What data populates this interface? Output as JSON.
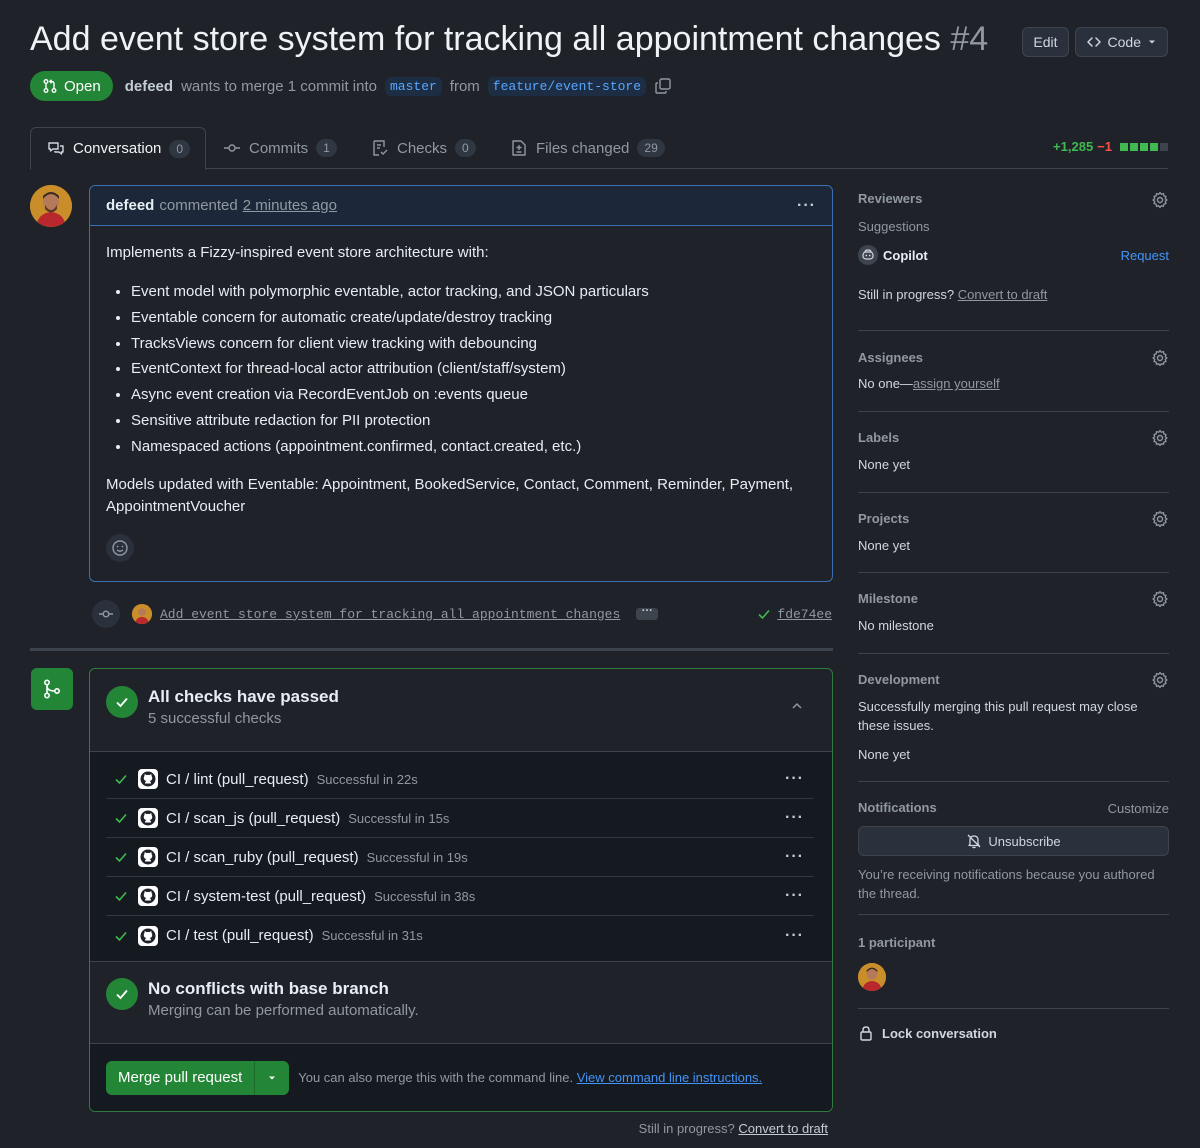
{
  "header": {
    "title": "Add event store system for tracking all appointment changes",
    "number": "#4",
    "edit_label": "Edit",
    "code_label": "Code",
    "state": "Open",
    "author": "defeed",
    "merge_text": "wants to merge 1 commit into",
    "base_branch": "master",
    "from_text": "from",
    "head_branch": "feature/event-store"
  },
  "tabs": [
    {
      "label": "Conversation",
      "count": "0"
    },
    {
      "label": "Commits",
      "count": "1"
    },
    {
      "label": "Checks",
      "count": "0"
    },
    {
      "label": "Files changed",
      "count": "29"
    }
  ],
  "diffstat": {
    "additions": "+1,285",
    "deletions": "−1",
    "colors": [
      "#3fb950",
      "#3fb950",
      "#3fb950",
      "#3fb950",
      "#3d444d"
    ]
  },
  "comment": {
    "author": "defeed",
    "action": "commented",
    "time": "2 minutes ago",
    "intro": "Implements a Fizzy-inspired event store architecture with:",
    "bullets": [
      "Event model with polymorphic eventable, actor tracking, and JSON particulars",
      "Eventable concern for automatic create/update/destroy tracking",
      "TracksViews concern for client view tracking with debouncing",
      "EventContext for thread-local actor attribution (client/staff/system)",
      "Async event creation via RecordEventJob on :events queue",
      "Sensitive attribute redaction for PII protection",
      "Namespaced actions (appointment.confirmed, contact.created, etc.)"
    ],
    "outro": "Models updated with Eventable: Appointment, BookedService, Contact, Comment, Reminder, Payment, AppointmentVoucher"
  },
  "commit": {
    "message": "Add event store system for tracking all appointment changes",
    "sha": "fde74ee"
  },
  "merge": {
    "checks_title": "All checks have passed",
    "checks_subtitle": "5 successful checks",
    "checks": [
      {
        "name": "CI / lint (pull_request)",
        "status": "Successful in 22s"
      },
      {
        "name": "CI / scan_js (pull_request)",
        "status": "Successful in 15s"
      },
      {
        "name": "CI / scan_ruby (pull_request)",
        "status": "Successful in 19s"
      },
      {
        "name": "CI / system-test (pull_request)",
        "status": "Successful in 38s"
      },
      {
        "name": "CI / test (pull_request)",
        "status": "Successful in 31s"
      }
    ],
    "conflicts_title": "No conflicts with base branch",
    "conflicts_subtitle": "Merging can be performed automatically.",
    "merge_button": "Merge pull request",
    "hint": "You can also merge this with the command line.",
    "hint_link": "View command line instructions.",
    "still_in_progress": "Still in progress?",
    "convert_to_draft": "Convert to draft"
  },
  "sidebar": {
    "reviewers": {
      "title": "Reviewers",
      "suggestions": "Suggestions",
      "copilot": "Copilot",
      "request": "Request",
      "still": "Still in progress?",
      "convert": "Convert to draft"
    },
    "assignees": {
      "title": "Assignees",
      "none": "No one—",
      "assign": "assign yourself"
    },
    "labels": {
      "title": "Labels",
      "value": "None yet"
    },
    "projects": {
      "title": "Projects",
      "value": "None yet"
    },
    "milestone": {
      "title": "Milestone",
      "value": "No milestone"
    },
    "development": {
      "title": "Development",
      "text": "Successfully merging this pull request may close these issues.",
      "value": "None yet"
    },
    "notifications": {
      "title": "Notifications",
      "customize": "Customize",
      "button": "Unsubscribe",
      "reason": "You’re receiving notifications because you authored the thread."
    },
    "participants": {
      "title": "1 participant"
    },
    "lock": "Lock conversation"
  },
  "colors": {
    "background": "#1f2329",
    "success": "#238636",
    "link": "#4493f8",
    "border": "#3d444d"
  }
}
